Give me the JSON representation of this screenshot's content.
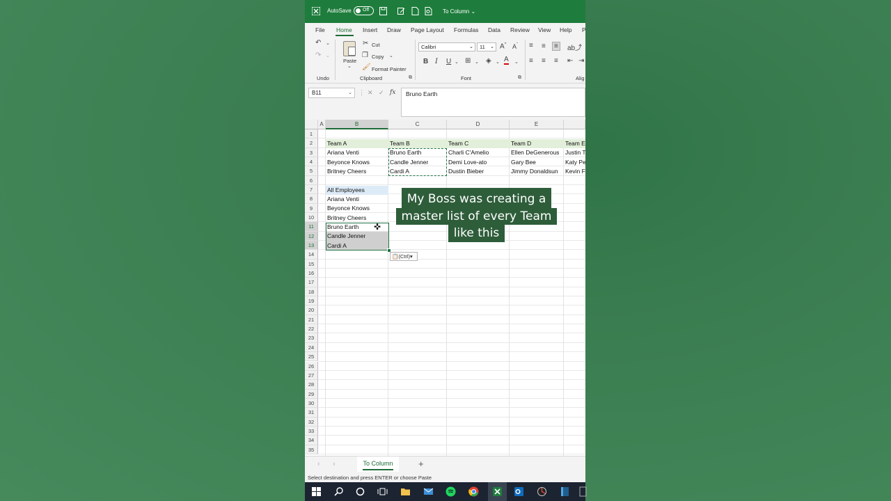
{
  "titlebar": {
    "autosave_label": "AutoSave",
    "autosave_state": "Off",
    "doc_name": "To Column ⌄"
  },
  "ribbon_tabs": [
    "File",
    "Home",
    "Insert",
    "Draw",
    "Page Layout",
    "Formulas",
    "Data",
    "Review",
    "View",
    "Help",
    "P"
  ],
  "ribbon": {
    "undo_group": "Undo",
    "paste": "Paste",
    "cut": "Cut",
    "copy": "Copy",
    "format_painter": "Format Painter",
    "clipboard_group": "Clipboard",
    "font_name": "Calibri",
    "font_size": "11",
    "grow": "A",
    "shrink": "A",
    "bold": "B",
    "italic": "I",
    "underline": "U",
    "font_group": "Font",
    "align_group": "Alig"
  },
  "formula_bar": {
    "name_box": "B11",
    "fx": "fx",
    "value": "Bruno Earth"
  },
  "columns": [
    "A",
    "B",
    "C",
    "D",
    "E"
  ],
  "rows": [
    "1",
    "2",
    "3",
    "4",
    "5",
    "6",
    "7",
    "8",
    "9",
    "10",
    "11",
    "12",
    "13",
    "14",
    "15",
    "16",
    "17",
    "18",
    "19",
    "20",
    "21",
    "22",
    "23",
    "24",
    "25",
    "26",
    "27",
    "28",
    "29",
    "30",
    "31",
    "32",
    "33",
    "34",
    "35"
  ],
  "cells": {
    "B2": "Team A",
    "C2": "Team B",
    "D2": "Team C",
    "E2": "Team D",
    "F2": "Team E",
    "B3": "Ariana Venti",
    "C3": "Bruno Earth",
    "D3": "Charli C'Amelio",
    "E3": "Ellen DeGenerous",
    "F3": "Justin T",
    "B4": "Beyonce Knows",
    "C4": "Candle Jenner",
    "D4": "Demi Love-ato",
    "E4": "Gary Bee",
    "F4": "Katy Pe",
    "B5": "Britney Cheers",
    "C5": "Cardi A",
    "D5": "Dustin Bieber",
    "E5": "Jimmy Donaldsun",
    "F5": "Kevin F",
    "B7": "All Employees",
    "B8": "Ariana Venti",
    "B9": "Beyonce Knows",
    "B10": "Britney Cheers",
    "B11": "Bruno Earth",
    "B12": "Candle Jenner",
    "B13": "Cardi A"
  },
  "paste_options": "(Ctrl)",
  "caption": [
    "My Boss was creating a",
    "master list of every Team",
    "like this"
  ],
  "sheet_tab": "To Column",
  "status": "Select destination and press ENTER or choose Paste",
  "colors": {
    "excel_green": "#1e7d3c",
    "header_fill": "#e2efda",
    "all_employees_fill": "#ddebf7",
    "caption_bg": "#2e5d3a"
  }
}
